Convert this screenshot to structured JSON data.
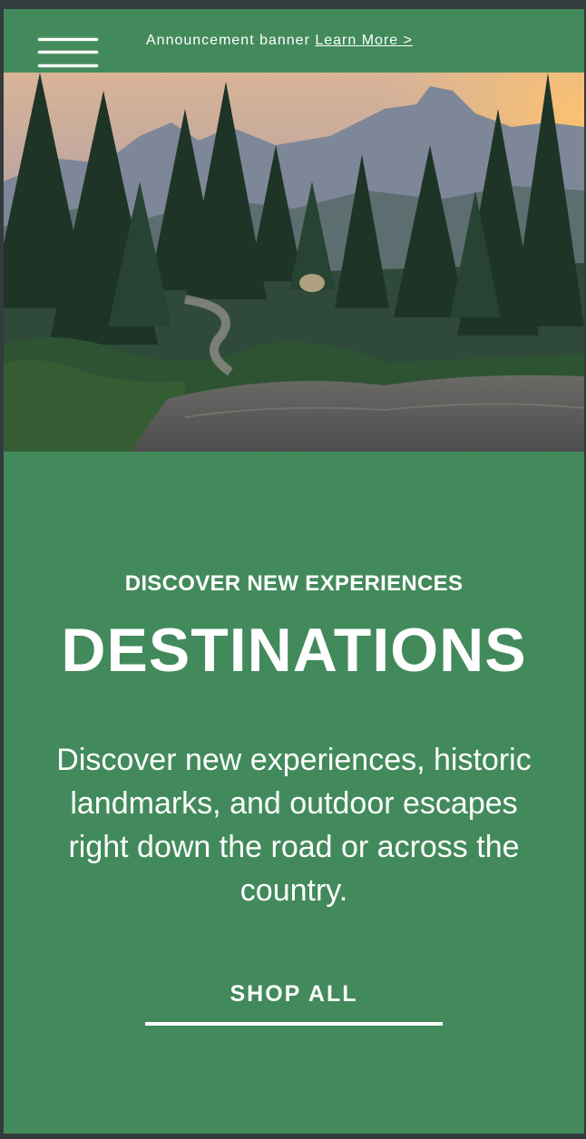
{
  "announcement": {
    "text": "Announcement banner ",
    "link_label": "Learn More >"
  },
  "hero": {
    "image_description_icon": "forest-mountain-landscape-image"
  },
  "main": {
    "eyebrow": "DISCOVER NEW EXPERIENCES",
    "headline": "DESTINATIONS",
    "description": "Discover new experiences, historic landmarks, and outdoor escapes right down the road or across the country.",
    "cta_label": "SHOP ALL"
  },
  "colors": {
    "brand_green": "#428a5b",
    "text": "#ffffff",
    "page_border": "#323b3e"
  }
}
